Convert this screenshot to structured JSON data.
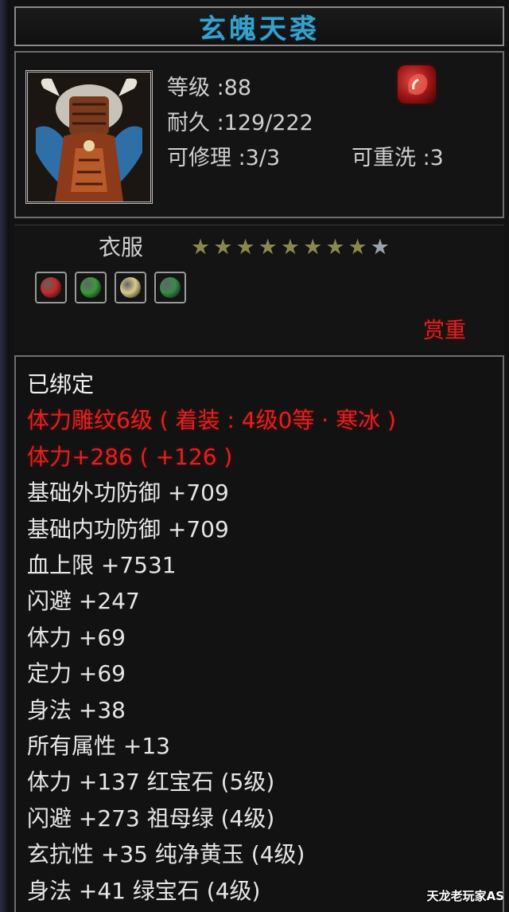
{
  "item": {
    "title": "玄魄天裘",
    "level_label": "等级 :88",
    "durability_label": "耐久 :129/222",
    "repairable_label": "可修理 :3/3",
    "rewash_label": "可重洗 :3",
    "badge_icon": "red-gem-badge-icon"
  },
  "category": {
    "label": "衣服",
    "stars_filled": 8,
    "stars_total": 9
  },
  "gem_slots": [
    {
      "icon": "red-gem-icon",
      "color": "#c42a2a"
    },
    {
      "icon": "green-gem-icon",
      "color": "#3a9a3a"
    },
    {
      "icon": "yellow-jade-icon",
      "color": "#d8cc8a"
    },
    {
      "icon": "green-gem-icon",
      "color": "#3a8a4a"
    }
  ],
  "reforge_label": "赏重",
  "attributes": [
    {
      "text": "已绑定",
      "style": "bound"
    },
    {
      "text": "体力雕纹6级 ( 着装 : 4级0等 · 寒冰 )",
      "style": "red"
    },
    {
      "text": "体力+286 ( +126 )",
      "style": "red"
    },
    {
      "text": "基础外功防御  +709",
      "style": "normal"
    },
    {
      "text": "基础内功防御  +709",
      "style": "normal"
    },
    {
      "text": "血上限  +7531",
      "style": "normal"
    },
    {
      "text": "闪避  +247",
      "style": "normal"
    },
    {
      "text": "体力  +69",
      "style": "normal"
    },
    {
      "text": "定力  +69",
      "style": "normal"
    },
    {
      "text": "身法  +38",
      "style": "normal"
    },
    {
      "text": "所有属性  +13",
      "style": "normal"
    },
    {
      "text": "体力  +137  红宝石 (5级)",
      "style": "normal"
    },
    {
      "text": "闪避  +273  祖母绿 (4级)",
      "style": "normal"
    },
    {
      "text": "玄抗性  +35  纯净黄玉 (4级)",
      "style": "normal"
    },
    {
      "text": "身法  +41  绿宝石 (4级)",
      "style": "normal"
    }
  ],
  "watermark": "天龙老玩家AS",
  "colors": {
    "title": "#3aa0c8",
    "attribute_text": "#e6e6e6",
    "engraving_red": "#d42626",
    "star_gold": "#8a8850",
    "star_empty": "#9ca3ab"
  }
}
